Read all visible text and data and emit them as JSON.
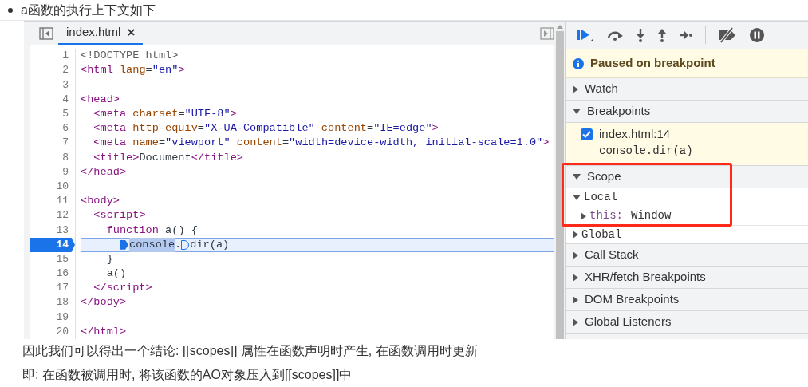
{
  "bullet_text": "a函数的执行上下文如下",
  "editor": {
    "tab": {
      "label": "index.html",
      "close": "×",
      "selected": true
    },
    "lines": [
      {
        "number": "1",
        "breakpoint": false,
        "tokens": [
          {
            "kind": "doctype",
            "text": "<!DOCTYPE html>"
          }
        ]
      },
      {
        "number": "2",
        "breakpoint": false,
        "tokens": [
          {
            "kind": "tag",
            "text": "<html"
          },
          {
            "kind": "attr",
            "text": " lang"
          },
          {
            "kind": "text",
            "text": "="
          },
          {
            "kind": "value",
            "text": "\"en\""
          },
          {
            "kind": "tag",
            "text": ">"
          }
        ]
      },
      {
        "number": "3",
        "breakpoint": false
      },
      {
        "number": "4",
        "breakpoint": false,
        "tokens": [
          {
            "kind": "tag",
            "text": "<head>"
          }
        ]
      },
      {
        "number": "5",
        "breakpoint": false,
        "tokens": [
          {
            "kind": "tag",
            "text": "  <meta"
          },
          {
            "kind": "attr",
            "text": " charset"
          },
          {
            "kind": "text",
            "text": "="
          },
          {
            "kind": "value",
            "text": "\"UTF-8\""
          },
          {
            "kind": "tag",
            "text": ">"
          }
        ]
      },
      {
        "number": "6",
        "breakpoint": false,
        "tokens": [
          {
            "kind": "tag",
            "text": "  <meta"
          },
          {
            "kind": "attr",
            "text": " http-equiv"
          },
          {
            "kind": "text",
            "text": "="
          },
          {
            "kind": "value",
            "text": "\"X-UA-Compatible\""
          },
          {
            "kind": "attr",
            "text": " content"
          },
          {
            "kind": "text",
            "text": "="
          },
          {
            "kind": "value",
            "text": "\"IE=edge\""
          },
          {
            "kind": "tag",
            "text": ">"
          }
        ]
      },
      {
        "number": "7",
        "breakpoint": false,
        "tokens": [
          {
            "kind": "tag",
            "text": "  <meta"
          },
          {
            "kind": "attr",
            "text": " name"
          },
          {
            "kind": "text",
            "text": "="
          },
          {
            "kind": "value",
            "text": "\"viewport\""
          },
          {
            "kind": "attr",
            "text": " content"
          },
          {
            "kind": "text",
            "text": "="
          },
          {
            "kind": "value",
            "text": "\"width=device-width, initial-scale=1.0\""
          },
          {
            "kind": "tag",
            "text": ">"
          }
        ]
      },
      {
        "number": "8",
        "breakpoint": false,
        "tokens": [
          {
            "kind": "tag",
            "text": "  <title>"
          },
          {
            "kind": "text",
            "text": "Document"
          },
          {
            "kind": "tag",
            "text": "</title>"
          }
        ]
      },
      {
        "number": "9",
        "breakpoint": false,
        "tokens": [
          {
            "kind": "tag",
            "text": "</head>"
          }
        ]
      },
      {
        "number": "10",
        "breakpoint": false
      },
      {
        "number": "11",
        "breakpoint": false,
        "tokens": [
          {
            "kind": "tag",
            "text": "<body>"
          }
        ]
      },
      {
        "number": "12",
        "breakpoint": false,
        "tokens": [
          {
            "kind": "tag",
            "text": "  <script>"
          }
        ]
      },
      {
        "number": "13",
        "breakpoint": false,
        "tokens": [
          {
            "kind": "keyword",
            "text": "    function"
          },
          {
            "kind": "text",
            "text": " a() {"
          }
        ]
      },
      {
        "number": "14",
        "breakpoint": true,
        "tokens": [
          {
            "kind": "marker"
          },
          {
            "kind": "selected",
            "text": "console"
          },
          {
            "kind": "text",
            "text": "."
          },
          {
            "kind": "marker"
          },
          {
            "kind": "text",
            "text": "dir(a)"
          }
        ]
      },
      {
        "number": "15",
        "breakpoint": false,
        "tokens": [
          {
            "kind": "text",
            "text": "    }"
          }
        ]
      },
      {
        "number": "16",
        "breakpoint": false,
        "tokens": [
          {
            "kind": "text",
            "text": "    a()"
          }
        ]
      },
      {
        "number": "17",
        "breakpoint": false,
        "tokens": [
          {
            "kind": "tag",
            "text": "  </script>"
          }
        ]
      },
      {
        "number": "18",
        "breakpoint": false,
        "tokens": [
          {
            "kind": "tag",
            "text": "</body>"
          }
        ]
      },
      {
        "number": "19",
        "breakpoint": false
      },
      {
        "number": "20",
        "breakpoint": false,
        "tokens": [
          {
            "kind": "tag",
            "text": "</html>"
          }
        ]
      }
    ]
  },
  "debugger": {
    "paused_message": "Paused on breakpoint",
    "sections": [
      {
        "title": "Watch",
        "expanded": false,
        "highlighted": false
      },
      {
        "title": "Breakpoints",
        "expanded": true,
        "highlighted": false,
        "breakpoints": [
          {
            "label": "index.html:14",
            "code": "console.dir(a)",
            "checked": true
          }
        ]
      },
      {
        "title": "Scope",
        "expanded": true,
        "highlighted": true,
        "scopes": [
          {
            "name": "Local",
            "expanded": true,
            "children": [
              {
                "name": "this:",
                "value": "Window",
                "expanded": false
              }
            ]
          },
          {
            "name": "Global",
            "expanded": false
          }
        ]
      },
      {
        "title": "Call Stack",
        "expanded": false,
        "highlighted": false
      },
      {
        "title": "XHR/fetch Breakpoints",
        "expanded": false,
        "highlighted": false
      },
      {
        "title": "DOM Breakpoints",
        "expanded": false,
        "highlighted": false
      },
      {
        "title": "Global Listeners",
        "expanded": false,
        "highlighted": false
      }
    ]
  },
  "paragraph": [
    "因此我们可以得出一个结论: [[scopes]] 属性在函数声明时产生, 在函数调用时更新",
    "即: 在函数被调用时, 将该函数的AO对象压入到[[scopes]]中"
  ]
}
